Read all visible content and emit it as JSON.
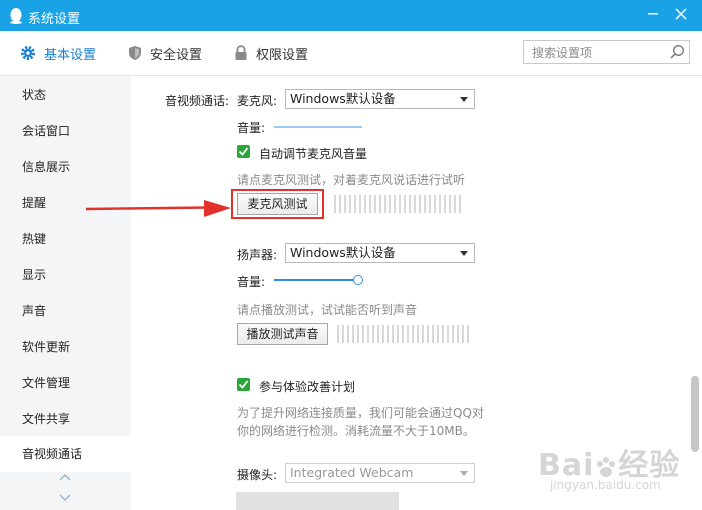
{
  "window": {
    "title": "系统设置"
  },
  "top_tabs": [
    {
      "label": "基本设置",
      "active": true
    },
    {
      "label": "安全设置",
      "active": false
    },
    {
      "label": "权限设置",
      "active": false
    }
  ],
  "search": {
    "placeholder": "搜索设置项"
  },
  "sidebar": {
    "items": [
      {
        "label": "状态"
      },
      {
        "label": "会话窗口"
      },
      {
        "label": "信息展示"
      },
      {
        "label": "提醒"
      },
      {
        "label": "热键"
      },
      {
        "label": "显示"
      },
      {
        "label": "声音"
      },
      {
        "label": "软件更新"
      },
      {
        "label": "文件管理"
      },
      {
        "label": "文件共享"
      },
      {
        "label": "音视频通话",
        "active": true
      }
    ]
  },
  "av": {
    "section_label": "音视频通话:",
    "mic": {
      "label": "麦克风:",
      "device": "Windows默认设备",
      "volume_label": "音量:",
      "auto_adjust_label": "自动调节麦克风音量",
      "auto_adjust_checked": true,
      "hint": "请点麦克风测试，对着麦克风说话进行试听",
      "test_button": "麦克风测试"
    },
    "speaker": {
      "label": "扬声器:",
      "device": "Windows默认设备",
      "volume_label": "音量:",
      "volume_level": 1.0,
      "hint": "请点播放测试，试试能否听到声音",
      "test_button": "播放测试声音"
    },
    "experience": {
      "label": "参与体验改善计划",
      "checked": true,
      "desc_line1": "为了提升网络连接质量，我们可能会通过QQ对",
      "desc_line2": "你的网络进行检测。消耗流量不大于10MB。"
    },
    "camera": {
      "label": "摄像头:",
      "device": "Integrated Webcam"
    }
  },
  "watermark": {
    "brand": "Bai",
    "brand2": "经验",
    "url": "jingyan.baidu.com"
  },
  "colors": {
    "titlebar": "#1aa2e6",
    "accent": "#1a7fd1",
    "highlight": "#e2322b",
    "checkbox": "#2aa53a"
  }
}
